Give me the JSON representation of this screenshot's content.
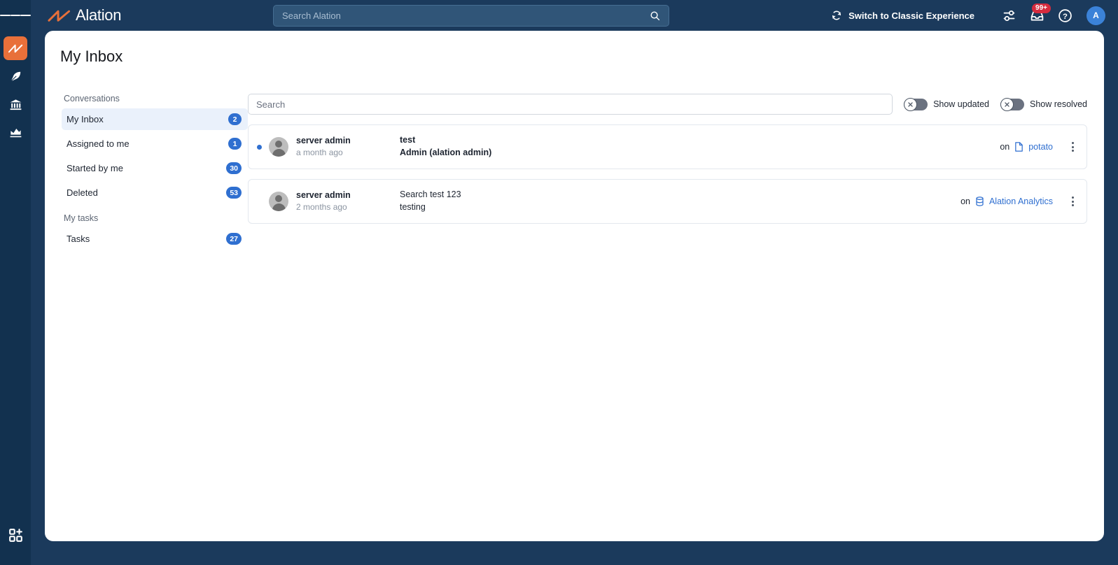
{
  "app": {
    "brand_name": "Alation",
    "logo_icon": "alation-bowtie-logo",
    "accent_orange": "#e8703a",
    "header_bg": "#1b3a5c",
    "rail_bg": "#12314f",
    "link_blue": "#2f6fd0"
  },
  "topbar": {
    "hamburger_icon": "hamburger-menu-icon",
    "global_search_placeholder": "Search Alation",
    "global_search_value": "",
    "search_icon": "search-icon",
    "switch_experience_label": "Switch to Classic Experience",
    "switch_experience_icon": "refresh-sync-icon",
    "settings_icon": "sliders-settings-icon",
    "inbox_icon": "inbox-tray-icon",
    "inbox_badge": "99+",
    "help_icon": "question-circle-help-icon",
    "avatar_initial": "A"
  },
  "rail": {
    "items": [
      {
        "icon": "alation-logo-icon",
        "name": "home",
        "active": true
      },
      {
        "icon": "feather-quill-icon",
        "name": "curation",
        "active": false
      },
      {
        "icon": "bank-institution-icon",
        "name": "governance",
        "active": false
      },
      {
        "icon": "chart-analytics-icon",
        "name": "analytics",
        "active": false
      }
    ],
    "bottom": {
      "icon": "grid-plus-apps-icon",
      "name": "apps"
    }
  },
  "page": {
    "title": "My Inbox"
  },
  "leftnav": {
    "groups": [
      {
        "title": "Conversations",
        "items": [
          {
            "label": "My Inbox",
            "count": "2",
            "active": true
          },
          {
            "label": "Assigned to me",
            "count": "1",
            "active": false
          },
          {
            "label": "Started by me",
            "count": "30",
            "active": false
          },
          {
            "label": "Deleted",
            "count": "53",
            "active": false
          }
        ]
      },
      {
        "title": "My tasks",
        "items": [
          {
            "label": "Tasks",
            "count": "27",
            "active": false
          }
        ]
      }
    ]
  },
  "filters": {
    "search_placeholder": "Search",
    "search_value": "",
    "toggles": [
      {
        "label": "Show updated",
        "state": "off",
        "icon": "x-circle-icon"
      },
      {
        "label": "Show resolved",
        "state": "off",
        "icon": "x-circle-icon"
      }
    ]
  },
  "conversations": [
    {
      "unread": true,
      "avatar_icon": "user-avatar-placeholder-icon",
      "user": "server admin",
      "time": "a month ago",
      "title": "test",
      "body": "Admin (alation admin)",
      "on_label": "on",
      "object_icon": "article-document-icon",
      "object_name": "potato",
      "menu_icon": "kebab-vertical-menu-icon"
    },
    {
      "unread": false,
      "avatar_icon": "user-avatar-placeholder-icon",
      "user": "server admin",
      "time": "2 months ago",
      "title": "Search test 123",
      "body": "testing",
      "on_label": "on",
      "object_icon": "database-cylinder-icon",
      "object_name": "Alation Analytics",
      "menu_icon": "kebab-vertical-menu-icon"
    }
  ]
}
